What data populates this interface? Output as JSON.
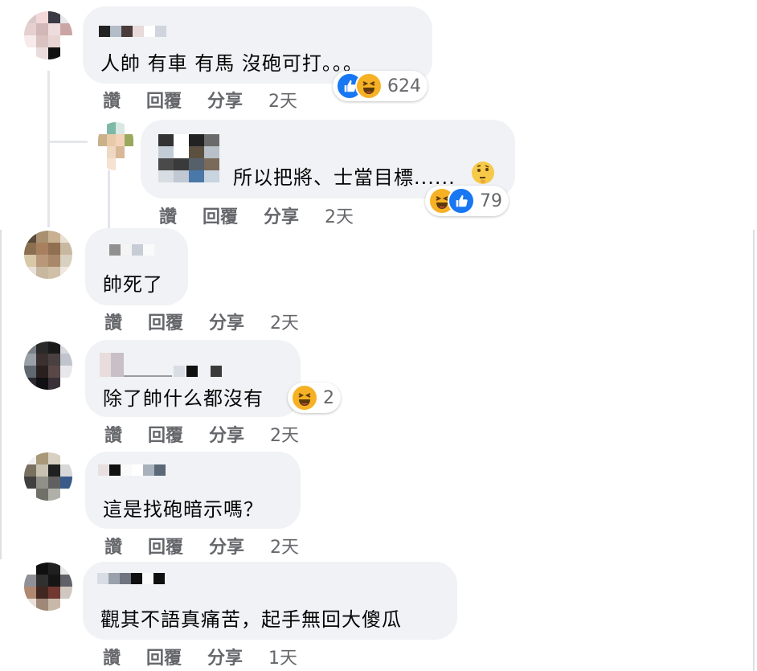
{
  "comments": [
    {
      "text": "人帥 有車 有馬 沒砲可打。。。",
      "actions": {
        "like": "讚",
        "reply": "回覆",
        "share": "分享",
        "time": "2天"
      },
      "reactions": {
        "icons": [
          "like-icon",
          "haha-icon"
        ],
        "count": "624"
      },
      "replies": [
        {
          "text": "所以把將、士當目標......",
          "trailing_emoji": "thinking-face-icon",
          "actions": {
            "like": "讚",
            "reply": "回覆",
            "share": "分享",
            "time": "2天"
          },
          "reactions": {
            "icons": [
              "haha-icon",
              "like-icon"
            ],
            "count": "79"
          }
        }
      ]
    },
    {
      "text": "帥死了",
      "actions": {
        "like": "讚",
        "reply": "回覆",
        "share": "分享",
        "time": "2天"
      }
    },
    {
      "text": "除了帥什么都沒有",
      "actions": {
        "like": "讚",
        "reply": "回覆",
        "share": "分享",
        "time": "2天"
      },
      "reactions": {
        "icons": [
          "haha-icon"
        ],
        "count": "2"
      }
    },
    {
      "text": "這是找砲暗示嗎？",
      "actions": {
        "like": "讚",
        "reply": "回覆",
        "share": "分享",
        "time": "2天"
      }
    },
    {
      "text": "觀其不語真痛苦，起手無回大傻瓜",
      "actions": {
        "like": "讚",
        "reply": "回覆",
        "share": "分享",
        "time": "1天"
      }
    }
  ],
  "colors": {
    "bubble": "#f0f2f5",
    "action_text": "#65676b",
    "like_blue": "#1877f2",
    "haha_yellow": "#f7b125"
  }
}
